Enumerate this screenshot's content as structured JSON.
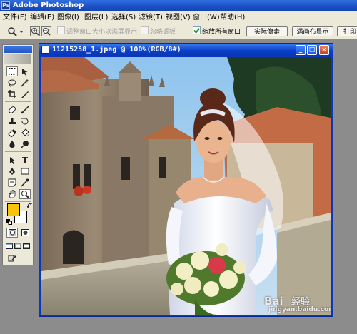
{
  "app": {
    "title": "Adobe Photoshop",
    "logo_text": "Ps"
  },
  "menu": [
    "文件(F)",
    "编辑(E)",
    "图像(I)",
    "图层(L)",
    "选择(S)",
    "滤镜(T)",
    "视图(V)",
    "窗口(W)",
    "帮助(H)"
  ],
  "options": {
    "resize_windows": "调整窗口大小以满屏显示",
    "ignore_palettes": "忽略调板",
    "zoom_all_windows": "缩放所有窗口",
    "zoom_all_checked": true,
    "actual_pixels": "实际像素",
    "fit_screen": "满画布显示",
    "print_size": "打印"
  },
  "document": {
    "title": "11215258_1.jpeg @ 100%(RGB/8#)",
    "minimize": "_",
    "maximize": "□",
    "close": "×"
  },
  "colors": {
    "foreground": "#f7c40a",
    "background": "#ffffff"
  },
  "watermark": {
    "logo": "Bai",
    "brand": "经验",
    "url": "jingyan.baidu.com"
  },
  "tools": [
    "marquee-tool",
    "move-tool",
    "lasso-tool",
    "magic-wand-tool",
    "crop-tool",
    "slice-tool",
    "healing-brush-tool",
    "brush-tool",
    "clone-stamp-tool",
    "history-brush-tool",
    "eraser-tool",
    "gradient-tool",
    "blur-tool",
    "dodge-tool",
    "path-select-tool",
    "type-tool",
    "pen-tool",
    "shape-tool",
    "notes-tool",
    "eyedropper-tool",
    "hand-tool",
    "zoom-tool"
  ]
}
